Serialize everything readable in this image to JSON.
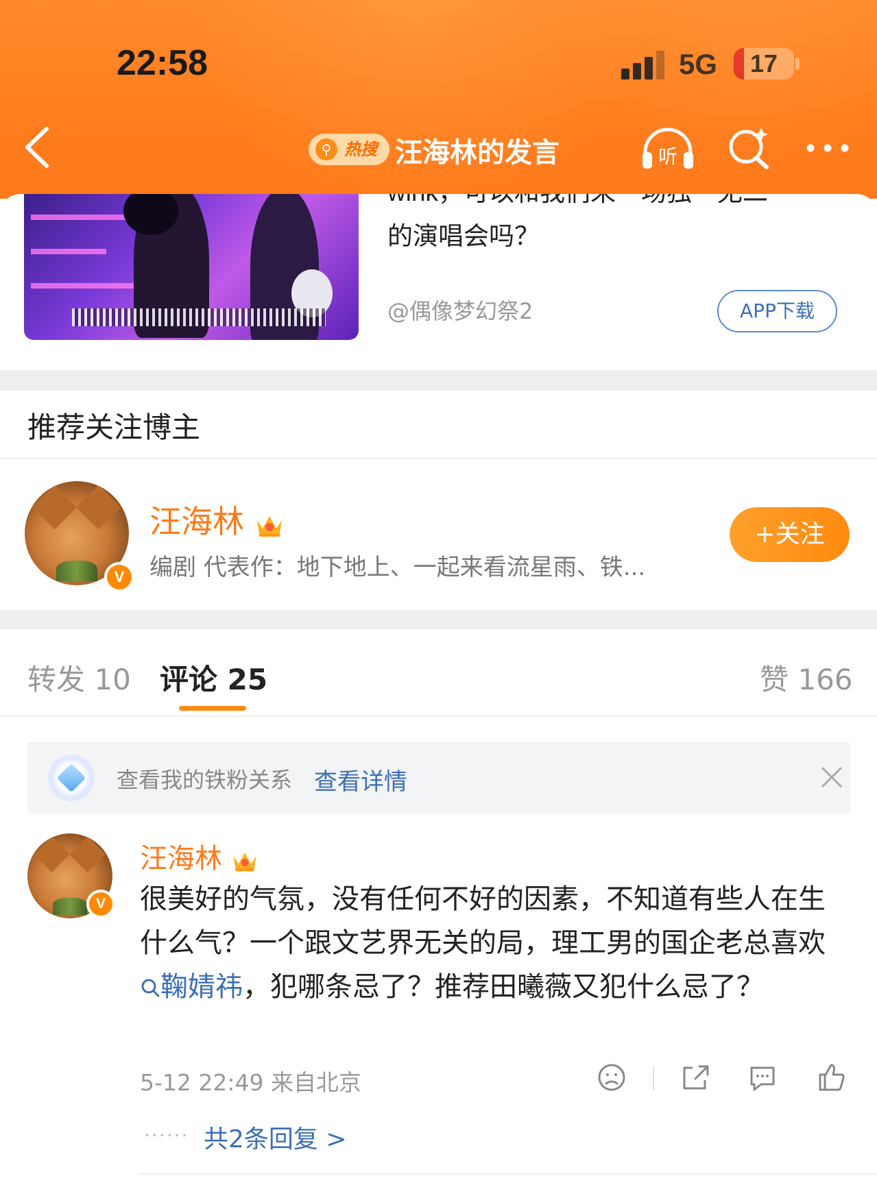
{
  "status_bar": {
    "time": "22:58",
    "network": "5G",
    "battery": "17",
    "battery_fraction": 0.17
  },
  "nav": {
    "hot_label": "热搜",
    "title": "汪海林的发言",
    "listen_label": "听"
  },
  "ad": {
    "text_partial": "wink，可以和我们来一场独一无二",
    "text_line2": "的演唱会吗？",
    "source": "@偶像梦幻祭2",
    "download_label": "APP下载"
  },
  "recommend": {
    "section_title": "推荐关注博主",
    "name": "汪海林",
    "verified_mark": "V",
    "description": "编剧 代表作：地下地上、一起来看流星雨、铁...",
    "follow_label": "+关注"
  },
  "tabs": {
    "repost": "转发 10",
    "comment": "评论 25",
    "like": "赞 166"
  },
  "fan_banner": {
    "text": "查看我的铁粉关系",
    "link": "查看详情"
  },
  "comment": {
    "author": "汪海林",
    "verified_mark": "V",
    "body_1": "很美好的气氛，没有任何不好的因素，不知道有些人在生什么气？一个跟文艺界无关的局，理工男的国企老总喜欢",
    "topic": "鞠婧祎",
    "body_2": "，犯哪条忌了？推荐田曦薇又犯什么忌了？",
    "meta": "5-12 22:49 来自北京",
    "replies_dots": "······",
    "replies": "共2条回复 >"
  },
  "colors": {
    "brand_orange": "#ff7a1a",
    "link_blue": "#3d6fb8"
  }
}
